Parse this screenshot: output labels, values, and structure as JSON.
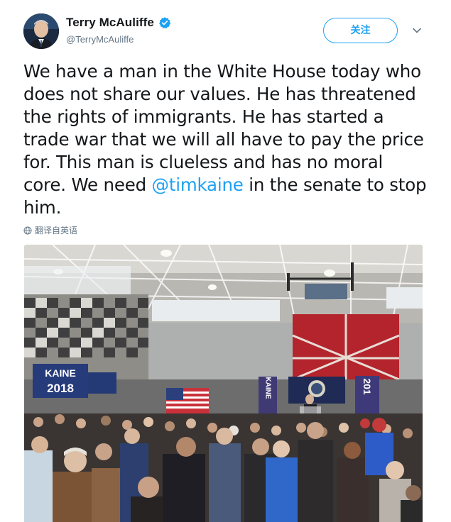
{
  "user": {
    "display_name": "Terry McAuliffe",
    "handle": "@TerryMcAuliffe",
    "verified": true
  },
  "follow_button": {
    "label": "关注"
  },
  "tweet": {
    "text_before": "We have a man in the White House  today who does not share our values. He has threatened the rights of immigrants. He has started a trade war that we will all have to pay the price for. This man is clueless and has no moral core. We need ",
    "mention": "@timkaine",
    "text_after": " in the senate to stop him."
  },
  "translate": {
    "label": "翻译自英语"
  },
  "photo": {
    "sign_left_line1": "KAINE",
    "sign_left_line2": "2018",
    "banner_mid": "KAINE",
    "banner_right": "201"
  },
  "icons": {
    "verified": "verified-badge-icon",
    "caret": "chevron-down-icon",
    "translate": "globe-icon"
  },
  "colors": {
    "accent": "#1da1f2",
    "text": "#14171a",
    "secondary": "#657786"
  }
}
